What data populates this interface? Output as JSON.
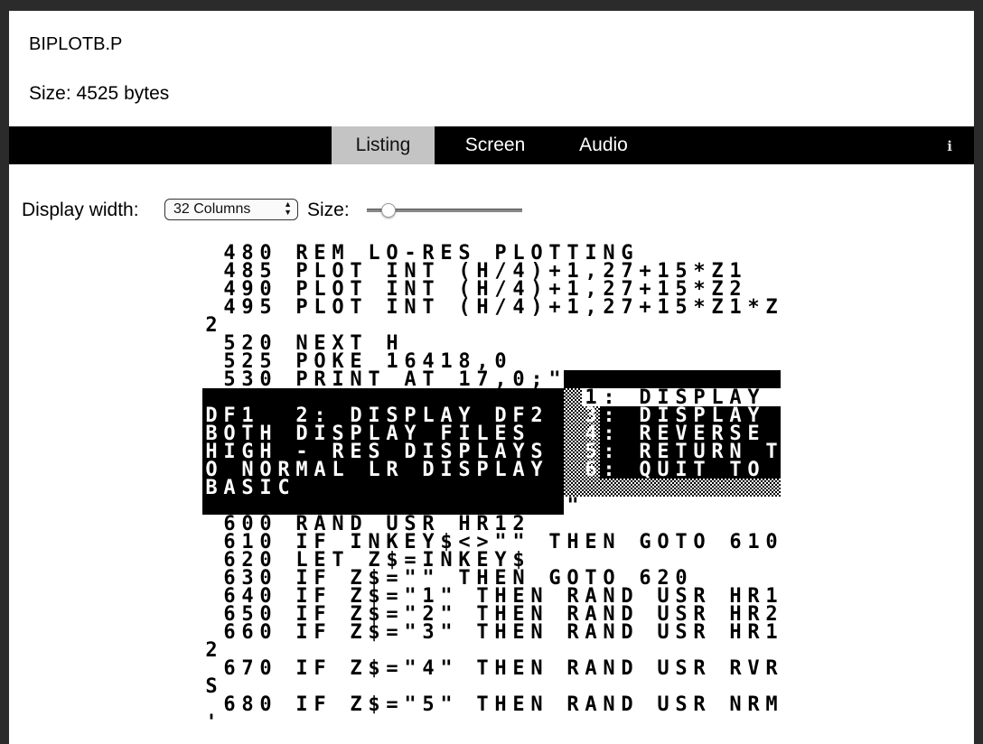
{
  "file": {
    "name": "BIPLOTB.P",
    "size_label": "Size: 4525 bytes"
  },
  "tabs": [
    {
      "label": "Listing",
      "active": true
    },
    {
      "label": "Screen",
      "active": false
    },
    {
      "label": "Audio",
      "active": false
    }
  ],
  "info_icon": {
    "glyph": "i",
    "icon": "info-icon"
  },
  "controls": {
    "display_width_label": "Display width:",
    "display_width_value": "32 Columns",
    "size_label": "Size:",
    "size_slider_fraction": 0.1
  },
  "listing": {
    "columns": 32,
    "rows": [
      " 480 REM LO-RES PLOTTING",
      " 485 PLOT INT (H/4)+1,27+15*Z1",
      " 490 PLOT INT (H/4)+1,27+15*Z2",
      " 495 PLOT INT (H/4)+1,27+15*Z1*Z",
      "2",
      " 520 NEXT H",
      " 525 POKE 16418,0",
      " 530 PRINT AT 17,0;\"~~~~~~~~~~~~",
      "~~~~~~~~~~~~~~~~~~~~ 1: DISPLAY ",
      "DF1  2: DISPLAY DF2  3: DISPLAY ",
      "BOTH DISPLAY FILES   4: REVERSE ",
      "HIGH - RES DISPLAYS  5: RETURN T",
      "O NORMAL LR DISPLAY  6: QUIT TO ",
      "BASIC               ~~~~~~~~~~~~",
      "~~~~~~~~~~~~~~~~~~~~\"",
      " 600 RAND USR HR12",
      " 610 IF INKEY$<>\"\" THEN GOTO 610",
      " 620 LET Z$=INKEY$",
      " 630 IF Z$=\"\" THEN GOTO 620",
      " 640 IF Z$=\"1\" THEN RAND USR HR1",
      " 650 IF Z$=\"2\" THEN RAND USR HR2",
      " 660 IF Z$=\"3\" THEN RAND USR HR1",
      "2",
      " 670 IF Z$=\"4\" THEN RAND USR RVR",
      "S",
      " 680 IF Z$=\"5\" THEN RAND USR NRM",
      "'"
    ],
    "inverse": [
      [
        7,
        20,
        32
      ],
      [
        8,
        0,
        20
      ],
      [
        9,
        0,
        32
      ],
      [
        10,
        0,
        32
      ],
      [
        11,
        0,
        32
      ],
      [
        12,
        0,
        32
      ],
      [
        13,
        0,
        32
      ],
      [
        14,
        0,
        20
      ]
    ],
    "checker": [
      [
        8,
        20,
        21
      ],
      [
        9,
        20,
        22
      ],
      [
        10,
        20,
        22
      ],
      [
        11,
        20,
        22
      ],
      [
        12,
        20,
        22
      ],
      [
        13,
        20,
        32
      ]
    ],
    "colors": {
      "ink": "#000000",
      "paper": "#ffffff"
    }
  }
}
